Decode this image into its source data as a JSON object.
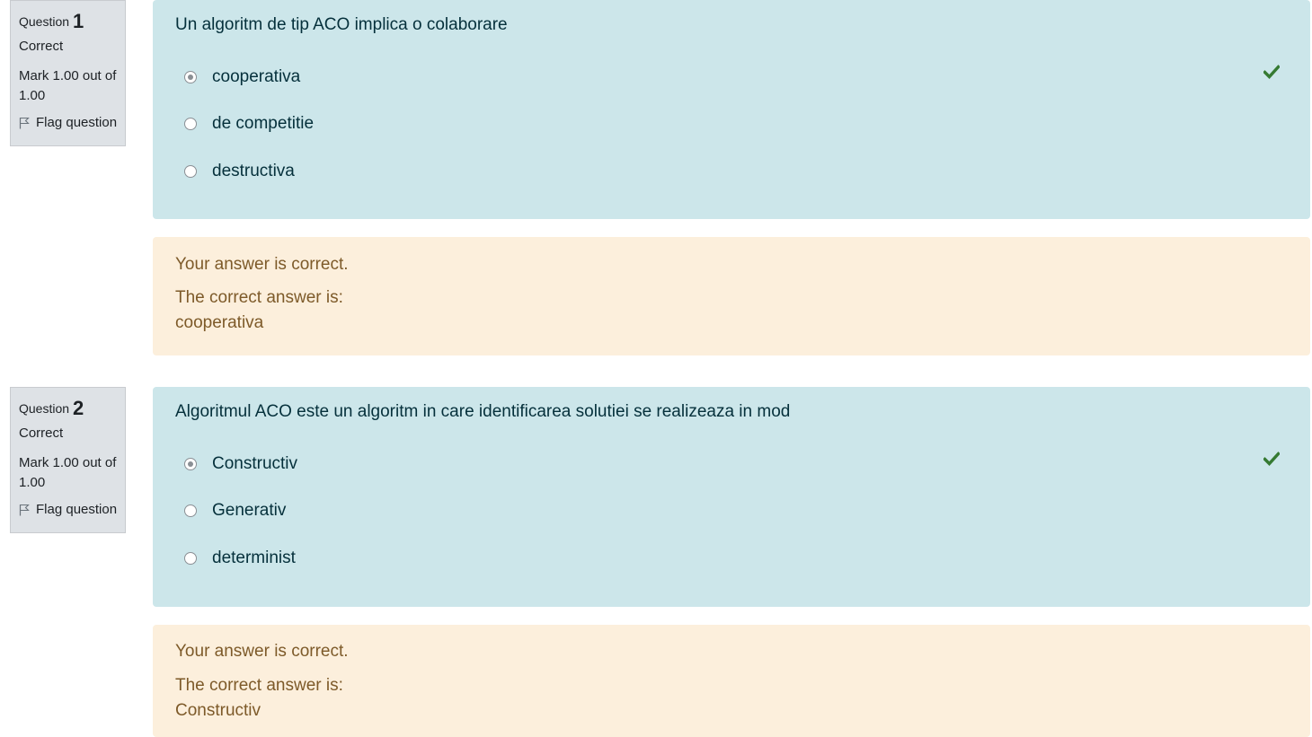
{
  "questions": [
    {
      "prefix": "Question",
      "number": "1",
      "state": "Correct",
      "grade": "Mark 1.00 out of 1.00",
      "flag_label": "Flag question",
      "text": "Un algoritm de tip ACO implica o colaborare",
      "options": [
        {
          "label": "cooperativa",
          "checked": true
        },
        {
          "label": "de competitie",
          "checked": false
        },
        {
          "label": "destructiva",
          "checked": false
        }
      ],
      "feedback": {
        "result": "Your answer is correct.",
        "correct_intro": "The correct answer is:",
        "correct_answer": "cooperativa"
      },
      "check_icon": "check-icon",
      "check_color": "#357a32"
    },
    {
      "prefix": "Question",
      "number": "2",
      "state": "Correct",
      "grade": "Mark 1.00 out of 1.00",
      "flag_label": "Flag question",
      "text": "Algoritmul ACO este un algoritm in care identificarea solutiei se realizeaza in mod",
      "options": [
        {
          "label": "Constructiv",
          "checked": true
        },
        {
          "label": "Generativ",
          "checked": false
        },
        {
          "label": "determinist",
          "checked": false
        }
      ],
      "feedback": {
        "result": "Your answer is correct.",
        "correct_intro": "The correct answer is:",
        "correct_answer": "Constructiv"
      },
      "check_icon": "check-icon",
      "check_color": "#357a32"
    }
  ],
  "colors": {
    "formulation_bg": "#cce6ea",
    "feedback_bg": "#fcefdc",
    "info_bg": "#dee2e6"
  }
}
